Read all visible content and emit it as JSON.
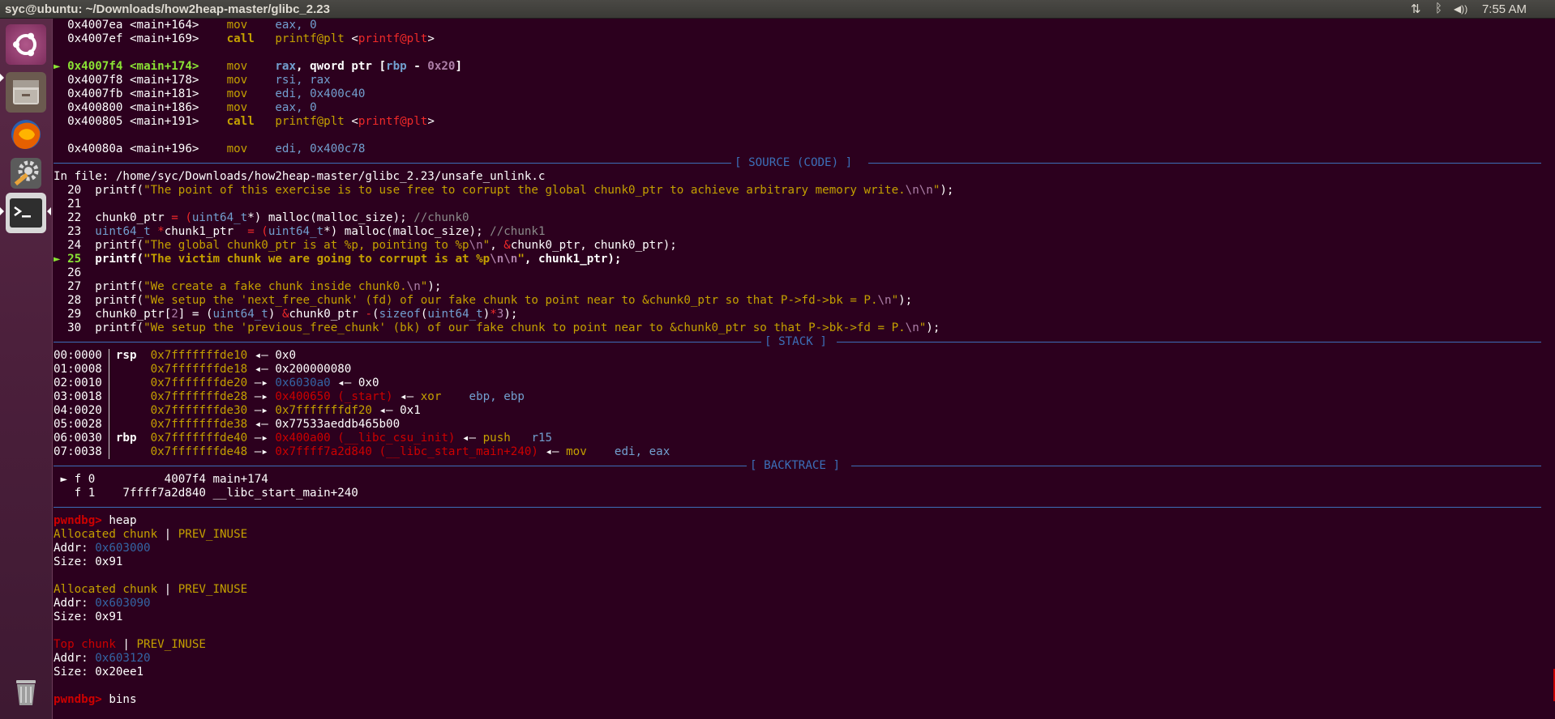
{
  "window": {
    "title": "syc@ubuntu: ~/Downloads/how2heap-master/glibc_2.23",
    "clock": "7:55 AM"
  },
  "tray": {
    "network": "⇅",
    "bluetooth": "ᛒ",
    "volume": "◀))"
  },
  "colors": {
    "background": "#2c001e",
    "accent_blue": "#3c6fb8",
    "yellow": "#c4a000",
    "red": "#cc0000",
    "green": "#8ae234"
  },
  "launcher": [
    {
      "name": "ubuntu-dash-icon"
    },
    {
      "name": "files-icon"
    },
    {
      "name": "firefox-icon"
    },
    {
      "name": "settings-icon"
    },
    {
      "name": "terminal-icon"
    },
    {
      "name": "trash-icon"
    }
  ],
  "disasm": [
    {
      "addr": "0x4007ea",
      "sym": "<main+164>",
      "op": "mov",
      "args": "eax, 0"
    },
    {
      "addr": "0x4007ef",
      "sym": "<main+169>",
      "op": "call",
      "args": "printf@plt",
      "tgt": "<printf@plt>"
    },
    {
      "addr": "0x4007f4",
      "sym": "<main+174>",
      "op": "mov",
      "a1": "rax",
      "a2": ", qword ptr [",
      "a3": "rbp",
      "a4": " - ",
      "a5": "0x20",
      "a6": "]"
    },
    {
      "addr": "0x4007f8",
      "sym": "<main+178>",
      "op": "mov",
      "args": "rsi, rax"
    },
    {
      "addr": "0x4007fb",
      "sym": "<main+181>",
      "op": "mov",
      "args": "edi, 0x400c40"
    },
    {
      "addr": "0x400800",
      "sym": "<main+186>",
      "op": "mov",
      "args": "eax, 0"
    },
    {
      "addr": "0x400805",
      "sym": "<main+191>",
      "op": "call",
      "args": "printf@plt",
      "tgt": "<printf@plt>"
    },
    {
      "addr": "0x40080a",
      "sym": "<main+196>",
      "op": "mov",
      "args": "edi, 0x400c78"
    }
  ],
  "sections": {
    "source": "[ SOURCE (CODE) ]",
    "stack": "[ STACK ]",
    "backtrace": "[ BACKTRACE ]"
  },
  "source": {
    "file_label": "In file: ",
    "file_path": "/home/syc/Downloads/how2heap-master/glibc_2.23/unsafe_unlink.c",
    "lines": [
      {
        "n": "20",
        "p1": "printf(",
        "s1": "\"The point of this exercise is to use free to corrupt the global chunk0_ptr to achieve arbitrary memory write.",
        "e1": "\\n\\n",
        "s2": "\"",
        "p2": ");"
      },
      {
        "n": "21"
      },
      {
        "n": "22",
        "a": "chunk0_ptr ",
        "b": "= (",
        "c": "uint64_t",
        "d": "*) malloc(malloc_size); ",
        "cm": "//chunk0"
      },
      {
        "n": "23",
        "a": "uint64_t ",
        "b": "*",
        "c": "chunk1_ptr  ",
        "d": "= (",
        "e": "uint64_t",
        "f": "*) malloc(malloc_size); ",
        "cm": "//chunk1"
      },
      {
        "n": "24",
        "p1": "printf(",
        "s1": "\"The global chunk0_ptr is at %p, pointing to %p",
        "e1": "\\n",
        "s2": "\"",
        "p2": ", ",
        "amp": "&",
        "p3": "chunk0_ptr, chunk0_ptr);"
      },
      {
        "n": "25",
        "p1": "printf(",
        "s1": "\"The victim chunk we are going to corrupt is at %p",
        "e1": "\\n\\n",
        "s2": "\"",
        "p2": ", chunk1_ptr);"
      },
      {
        "n": "26"
      },
      {
        "n": "27",
        "p1": "printf(",
        "s1": "\"We create a fake chunk inside chunk0.",
        "e1": "\\n",
        "s2": "\"",
        "p2": ");"
      },
      {
        "n": "28",
        "p1": "printf(",
        "s1": "\"We setup the 'next_free_chunk' (fd) of our fake chunk to point near to &chunk0_ptr so that P->fd->bk = P.",
        "e1": "\\n",
        "s2": "\"",
        "p2": ");"
      },
      {
        "n": "29",
        "a": "chunk0_ptr[",
        "b": "2",
        "c": "] = (",
        "d": "uint64_t",
        "e": ") ",
        "f": "&",
        "g": "chunk0_ptr ",
        "h": "-",
        "i": "(",
        "j": "sizeof",
        "k": "(",
        "l": "uint64_t",
        "m": ")",
        "o": "*",
        "q": "3",
        "r": ");"
      },
      {
        "n": "30",
        "p1": "printf(",
        "s1": "\"We setup the 'previous_free_chunk' (bk) of our fake chunk to point near to &chunk0_ptr so that P->bk->fd = P.",
        "e1": "\\n",
        "s2": "\"",
        "p2": ");"
      }
    ]
  },
  "stack": [
    {
      "off": "00:0000",
      "reg": "rsp",
      "addr": "0x7fffffffde10",
      "arrow": " ◂— ",
      "val": "0x0"
    },
    {
      "off": "01:0008",
      "reg": "",
      "addr": "0x7fffffffde18",
      "arrow": " ◂— ",
      "val": "0x200000080"
    },
    {
      "off": "02:0010",
      "reg": "",
      "addr": "0x7fffffffde20",
      "arrow": " —▸ ",
      "val": "0x6030a0",
      "arrow2": " ◂— ",
      "val2": "0x0"
    },
    {
      "off": "03:0018",
      "reg": "",
      "addr": "0x7fffffffde28",
      "arrow": " —▸ ",
      "val": "0x400650 (_start)",
      "arrow2": " ◂— ",
      "ins": "xor    ",
      "args": "ebp, ebp"
    },
    {
      "off": "04:0020",
      "reg": "",
      "addr": "0x7fffffffde30",
      "arrow": " —▸ ",
      "val": "0x7fffffffdf20",
      "arrow2": " ◂— ",
      "val2": "0x1"
    },
    {
      "off": "05:0028",
      "reg": "",
      "addr": "0x7fffffffde38",
      "arrow": " ◂— ",
      "val": "0x77533aeddb465b00"
    },
    {
      "off": "06:0030",
      "reg": "rbp",
      "addr": "0x7fffffffde40",
      "arrow": " —▸ ",
      "val": "0x400a00 (__libc_csu_init)",
      "arrow2": " ◂— ",
      "ins": "push   ",
      "args": "r15"
    },
    {
      "off": "07:0038",
      "reg": "",
      "addr": "0x7fffffffde48",
      "arrow": " —▸ ",
      "val": "0x7ffff7a2d840 (__libc_start_main+240)",
      "arrow2": " ◂— ",
      "ins": "mov    ",
      "args": "edi, eax"
    }
  ],
  "backtrace": [
    {
      "marker": "► f 0",
      "addr": "          4007f4 main+174"
    },
    {
      "marker": "  f 1",
      "addr": "    7ffff7a2d840 __libc_start_main+240"
    }
  ],
  "heap": {
    "prompt": "pwndbg> ",
    "cmd": "heap",
    "chunks": [
      {
        "type": "Allocated chunk",
        "sep": " | ",
        "flag": "PREV_INUSE",
        "addr_label": "Addr: ",
        "addr": "0x603000",
        "size_label": "Size: ",
        "size": "0x91"
      },
      {
        "type": "Allocated chunk",
        "sep": " | ",
        "flag": "PREV_INUSE",
        "addr_label": "Addr: ",
        "addr": "0x603090",
        "size_label": "Size: ",
        "size": "0x91"
      },
      {
        "type": "Top chunk",
        "sep": " | ",
        "flag": "PREV_INUSE",
        "addr_label": "Addr: ",
        "addr": "0x603120",
        "size_label": "Size: ",
        "size": "0x20ee1"
      }
    ],
    "cmd2": "bins"
  }
}
